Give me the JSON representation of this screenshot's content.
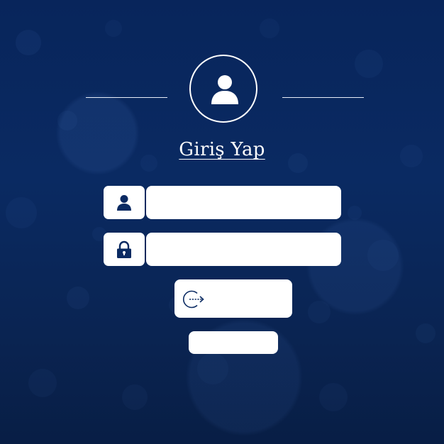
{
  "login": {
    "title": "Giriş Yap",
    "username": {
      "value": "",
      "placeholder": "",
      "icon": "user-icon"
    },
    "password": {
      "value": "",
      "placeholder": "",
      "icon": "lock-icon"
    },
    "submit_label": "",
    "submit_icon": "login-icon",
    "secondary_label": ""
  },
  "header": {
    "avatar_icon": "user-avatar-icon"
  },
  "colors": {
    "background": "#0a2a62",
    "foreground": "#ffffff",
    "icon": "#0a2a62"
  }
}
